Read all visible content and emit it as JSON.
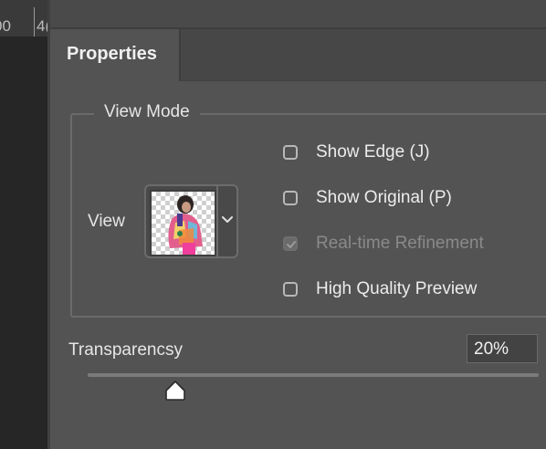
{
  "ruler": {
    "labels": [
      "00",
      "4("
    ]
  },
  "panel": {
    "tab_title": "Properties"
  },
  "view_mode": {
    "group_title": "View Mode",
    "view_label": "View",
    "thumbnail_alt": "view mode thumbnail",
    "options": [
      {
        "label": "Show Edge (J)",
        "checked": false,
        "disabled": false
      },
      {
        "label": "Show Original (P)",
        "checked": false,
        "disabled": false
      },
      {
        "label": "Real-time Refinement",
        "checked": true,
        "disabled": true
      },
      {
        "label": "High Quality Preview",
        "checked": false,
        "disabled": false
      }
    ]
  },
  "transparency": {
    "label": "Transparencsy",
    "value_text": "20%",
    "value": 20
  },
  "icons": [
    "chevron-down-icon",
    "checkbox-icon",
    "checkmark-icon",
    "slider-thumb-icon"
  ],
  "colors": {
    "panel_bg": "#535353",
    "canvas_bg": "#262626",
    "text": "#e6e6e6",
    "disabled_text": "#8a8a8a"
  }
}
